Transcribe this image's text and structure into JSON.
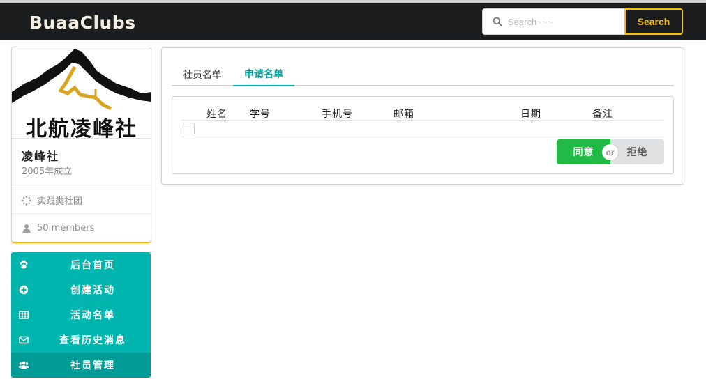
{
  "header": {
    "brand": "BuaaClubs",
    "search_placeholder": "Search~~~",
    "search_button": "Search"
  },
  "club": {
    "logo_text": "北航凌峰社",
    "name": "凌峰社",
    "founded": "2005年成立",
    "category": "实践类社团",
    "members": "50 members"
  },
  "menu": {
    "items": [
      {
        "label": "后台首页",
        "icon": "paw-icon"
      },
      {
        "label": "创建活动",
        "icon": "plus-circle-icon"
      },
      {
        "label": "活动名单",
        "icon": "table-icon"
      },
      {
        "label": "查看历史消息",
        "icon": "envelope-icon"
      },
      {
        "label": "社员管理",
        "icon": "users-icon"
      }
    ],
    "active_index": 4
  },
  "tabs": [
    {
      "label": "社员名单"
    },
    {
      "label": "申请名单"
    }
  ],
  "table": {
    "columns": [
      "姓名",
      "学号",
      "手机号",
      "邮箱",
      "日期",
      "备注"
    ],
    "rows": []
  },
  "actions": {
    "agree": "同意",
    "or": "or",
    "reject": "拒绝"
  },
  "colors": {
    "teal": "#00b5ad",
    "yellow": "#fbbd08",
    "green": "#21ba45",
    "dark": "#1b1c1d"
  }
}
